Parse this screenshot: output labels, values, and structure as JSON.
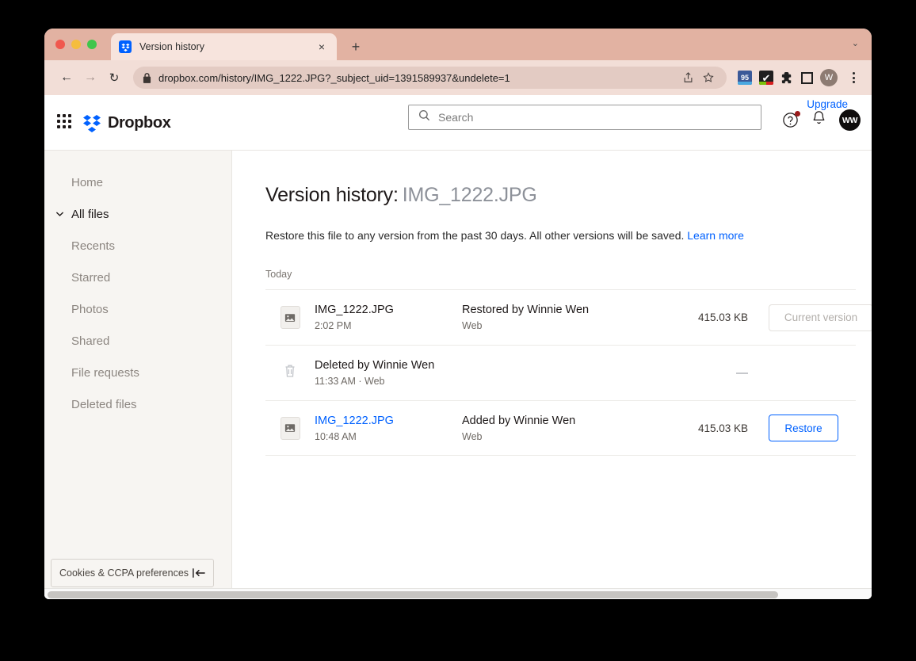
{
  "browser": {
    "tab": {
      "title": "Version history",
      "favicon": "dropbox-favicon",
      "close_label": "×"
    },
    "new_tab_label": "+",
    "tabstrip_chevron": "⌄",
    "nav": {
      "back": "←",
      "forward": "→",
      "reload": "↻"
    },
    "url": "dropbox.com/history/IMG_1222.JPG?_subject_uid=1391589937&undelete=1",
    "omnibox_actions": [
      "share-icon",
      "bookmark-star-icon"
    ],
    "extensions": [
      {
        "name": "badge-95-extension",
        "label": "95"
      },
      {
        "name": "checkmark-extension",
        "label": "✔"
      },
      {
        "name": "puzzle-extension-icon",
        "label": ""
      },
      {
        "name": "square-extension-icon",
        "label": ""
      }
    ],
    "profile_initial": "W",
    "menu": "kebab-menu-icon"
  },
  "header": {
    "grid_icon": "app-grid-icon",
    "logo_text": "Dropbox",
    "search": {
      "placeholder": "Search",
      "value": ""
    },
    "upgrade_label": "Upgrade",
    "help_icon": "help-circle-icon",
    "notifications_icon": "bell-icon",
    "avatar_initials": "WW"
  },
  "sidebar": {
    "items": [
      {
        "label": "Home",
        "active": false
      },
      {
        "label": "All files",
        "active": true
      },
      {
        "label": "Recents",
        "active": false
      },
      {
        "label": "Starred",
        "active": false
      },
      {
        "label": "Photos",
        "active": false
      },
      {
        "label": "Shared",
        "active": false
      },
      {
        "label": "File requests",
        "active": false
      },
      {
        "label": "Deleted files",
        "active": false
      }
    ],
    "cookie_preferences_label": "Cookies & CCPA preferences",
    "collapse_icon": "collapse-sidebar-icon"
  },
  "main": {
    "title_prefix": "Version history:",
    "file_name": "IMG_1222.JPG",
    "description": "Restore this file to any version from the past 30 days. All other versions will be saved.",
    "learn_more_label": "Learn more",
    "day_label": "Today",
    "rows": [
      {
        "type": "file",
        "icon": "image-file-icon",
        "name": "IMG_1222.JPG",
        "name_is_link": false,
        "time": "2:02 PM",
        "action": "Restored by Winnie Wen",
        "source": "Web",
        "size": "415.03 KB",
        "button_label": "Current version",
        "button_state": "disabled"
      },
      {
        "type": "deleted",
        "icon": "trash-icon",
        "name": "Deleted by Winnie Wen",
        "name_is_link": false,
        "time": "11:33 AM · Web",
        "action": "",
        "source": "",
        "size": "—",
        "button_label": "",
        "button_state": "none"
      },
      {
        "type": "file",
        "icon": "image-file-icon",
        "name": "IMG_1222.JPG",
        "name_is_link": true,
        "time": "10:48 AM",
        "action": "Added by Winnie Wen",
        "source": "Web",
        "size": "415.03 KB",
        "button_label": "Restore",
        "button_state": "enabled"
      }
    ]
  },
  "colors": {
    "brand_blue": "#0061ff",
    "tabstrip": "#e2b2a2",
    "toolbar": "#f2ded7",
    "sidebar_bg": "#f7f5f2",
    "notification_dot": "#9b1b1b"
  }
}
